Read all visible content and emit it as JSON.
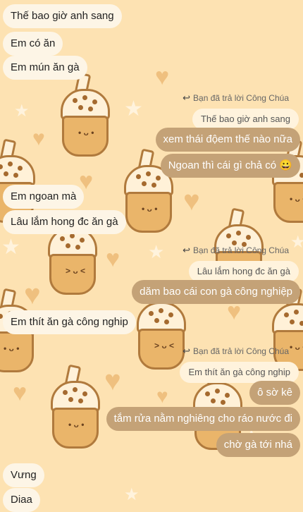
{
  "colors": {
    "background": "#fde2b2",
    "incoming_bubble": "#fdf5e6",
    "outgoing_bubble": "#c4a277",
    "quote_bubble": "#fff3dd"
  },
  "messages": [
    {
      "side": "left",
      "text": "Thế bao giờ anh sang"
    },
    {
      "side": "left",
      "text": "Em có ăn"
    },
    {
      "side": "left",
      "text": "Em mún ăn gà"
    },
    {
      "reply_label": "Bạn đã trả lời Công Chúa",
      "quoted": "Thế bao giờ anh sang"
    },
    {
      "side": "right",
      "text": "xem thái độem thế nào nữa"
    },
    {
      "side": "right",
      "text": "Ngoan thì cái gì chả có 😀"
    },
    {
      "side": "left",
      "text": "Em ngoan mà"
    },
    {
      "side": "left",
      "text": "Lâu lắm hong đc ăn gà"
    },
    {
      "reply_label": "Bạn đã trả lời Công Chúa",
      "quoted": "Lâu lắm hong đc ăn gà"
    },
    {
      "side": "right",
      "text": "dăm bao cái con gà công nghiệp"
    },
    {
      "side": "left",
      "text": "Em thít ăn gà công nghip"
    },
    {
      "reply_label": "Bạn đã trả lời Công Chúa",
      "quoted": "Em thít ăn gà công nghip"
    },
    {
      "side": "right",
      "text": "ô sờ kê"
    },
    {
      "side": "right",
      "text": "tắm rửa nằm nghiêng cho ráo nước đi"
    },
    {
      "side": "right",
      "text": "chờ gà tới nhá"
    },
    {
      "side": "left",
      "text": "Vưng"
    },
    {
      "side": "left",
      "text": "Diaa"
    }
  ]
}
